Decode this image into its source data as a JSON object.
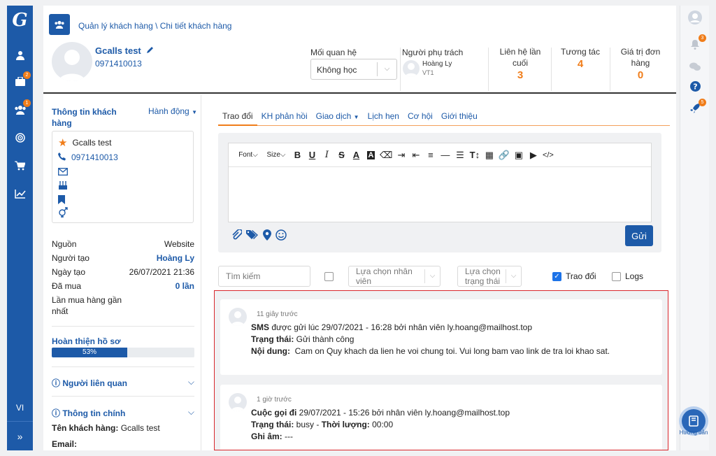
{
  "left_sidebar": {
    "lang": "VI",
    "badges": {
      "briefcase": "2",
      "users": "1"
    }
  },
  "right_sidebar": {
    "bell_badge": "3",
    "rocket_badge": "5",
    "help_label": "Hướng dẫn"
  },
  "header": {
    "breadcrumb": "Quản lý khách hàng \\ Chi tiết khách hàng",
    "customer_name": "Gcalls test",
    "customer_phone": "0971410013",
    "relationship_label": "Mối quan hệ",
    "relationship_value": "Không học",
    "owner_label": "Người phụ trách",
    "owner_name": "Hoàng Ly",
    "owner_sub": "VT1",
    "stats": [
      {
        "label1": "Liên hệ lần",
        "label2": "cuối",
        "value": "3"
      },
      {
        "label1": "Tương tác",
        "label2": "",
        "value": "4"
      },
      {
        "label1": "Giá trị đơn",
        "label2": "hàng",
        "value": "0"
      }
    ]
  },
  "left_panel": {
    "title": "Thông tin khách hàng",
    "action": "Hành động",
    "info_name": "Gcalls test",
    "info_phone": "0971410013",
    "rows": [
      {
        "k": "Nguồn",
        "v": "Website"
      },
      {
        "k": "Người tạo",
        "v": "Hoàng Ly"
      },
      {
        "k": "Ngày tạo",
        "v": "26/07/2021 21:36"
      },
      {
        "k": "Đã mua",
        "v": "0 lần"
      }
    ],
    "last_purchase_label": "Lần mua hàng gần nhất",
    "profile_title": "Hoàn thiện hồ sơ",
    "profile_progress": "53%",
    "related_title": "Người liên quan",
    "main_info_title": "Thông tin chính",
    "main_name_label": "Tên khách hàng:",
    "main_name_value": "Gcalls test",
    "email_label": "Email:"
  },
  "tabs": [
    "Trao đổi",
    "KH phản hồi",
    "Giao dịch",
    "Lịch hẹn",
    "Cơ hội",
    "Giới thiệu"
  ],
  "editor": {
    "font_label": "Font",
    "size_label": "Size",
    "send_label": "Gửi"
  },
  "filters": {
    "search_placeholder": "Tìm kiếm",
    "staff_placeholder": "Lựa chọn nhân viên",
    "status_placeholder": "Lựa chọn trạng thái",
    "trao_doi_label": "Trao đổi",
    "logs_label": "Logs"
  },
  "feed": [
    {
      "time": "11 giây trước",
      "line1_bold": "SMS",
      "line1_rest": " được gửi lúc 29/07/2021 - 16:28 bởi nhân viên ly.hoang@mailhost.top",
      "line2_bold": "Trạng thái:",
      "line2_rest": " Gửi thành công",
      "line3_bold": "Nội dung:",
      "line3_rest": "  Cam on Quy khach da lien he voi chung toi. Vui long bam vao link de tra loi khao sat."
    },
    {
      "time": "1 giờ trước",
      "line1_bold": "Cuộc gọi đi",
      "line1_rest": " 29/07/2021 - 15:26 bởi nhân viên ly.hoang@mailhost.top",
      "line2_bold": "Trạng thái:",
      "line2_rest": " busy - ",
      "line2_bold2": "Thời lượng:",
      "line2_rest2": " 00:00",
      "line3_bold": "Ghi âm:",
      "line3_rest": " ---"
    }
  ]
}
